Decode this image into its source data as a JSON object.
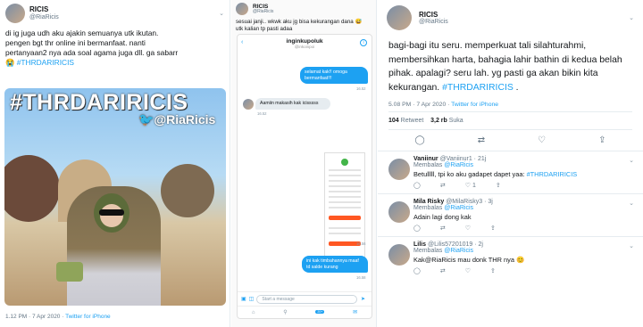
{
  "panel1": {
    "name": "RICIS",
    "handle": "@RiaRicis",
    "text_lines": [
      "di ig juga udh aku ajakin semuanya utk ikutan.",
      "pengen bgt thr online ini bermanfaat. nanti",
      "pertanyaan2 nya ada soal agama juga dll. ga sabarr"
    ],
    "emoji_hashtag_prefix": "😭",
    "hashtag": "#THRDARIRICIS",
    "photo_title": "#THRDARIRICIS",
    "photo_handle": "@RiaRicis",
    "time": "1.12 PM · 7 Apr 2020 · ",
    "source": "Twitter for iPhone"
  },
  "panel2": {
    "name": "RICIS",
    "handle": "@RiaRicis",
    "text_line1": "sesuai janji.. wkwk aku jg bisa kekurangan dana 😅",
    "text_line2": "utk kalian tp pasti adaa",
    "phone": {
      "title": "inginkupoluk",
      "subtitle": "@inkoinpoi",
      "msg_out_1": "selamat kak!! omoga bermanfaat!!!",
      "time_1": "16.52",
      "msg_in_1": "Aamiin makasih kak icisssss",
      "time_2": "16.52",
      "time_3": "16.56",
      "msg_out_2": "ini kak timbahannya maaf td salde kurang",
      "time_4": "16.58",
      "compose_placeholder": "Start a message",
      "badge": "20+"
    }
  },
  "panel3": {
    "name": "RICIS",
    "handle": "@RiaRicis",
    "text": "bagi-bagi itu seru. memperkuat tali silahturahmi, membersihkan harta, bahagia lahir bathin di kedua belah pihak. apalagi? seru lah. yg pasti ga akan bikin kita kekurangan.",
    "hashtag": "#THRDARIRICIS",
    "text_end": " .",
    "time": "5.08 PM · 7 Apr 2020 · ",
    "source": "Twitter for iPhone",
    "retweets_count": "104",
    "retweets_label": "Retweet",
    "likes_count": "3,2 rb",
    "likes_label": "Suka",
    "replies": [
      {
        "name": "Vaniinur",
        "handle": "@Vaniinur1 · 21j",
        "replying_label": "Membalas",
        "replying_to": "@RiaRicis",
        "body": "Betulllll, tpi ko aku gadapet dapet yaa:",
        "hashtag": "#THRDARIRICIS",
        "like": "1"
      },
      {
        "name": "Mila Risky",
        "handle": "@MilaRisky3 · 3j",
        "replying_label": "Membalas",
        "replying_to": "@RiaRicis",
        "body": "Adain lagi dong kak"
      },
      {
        "name": "Lilis",
        "handle": "@Lilis57201019 · 2j",
        "replying_label": "Membalas",
        "replying_to": "@RiaRicis",
        "body": "Kak@RiaRicis mau donk THR nya 😊"
      }
    ]
  },
  "colors": {
    "accent": "#1da1f2",
    "muted": "#657786"
  }
}
